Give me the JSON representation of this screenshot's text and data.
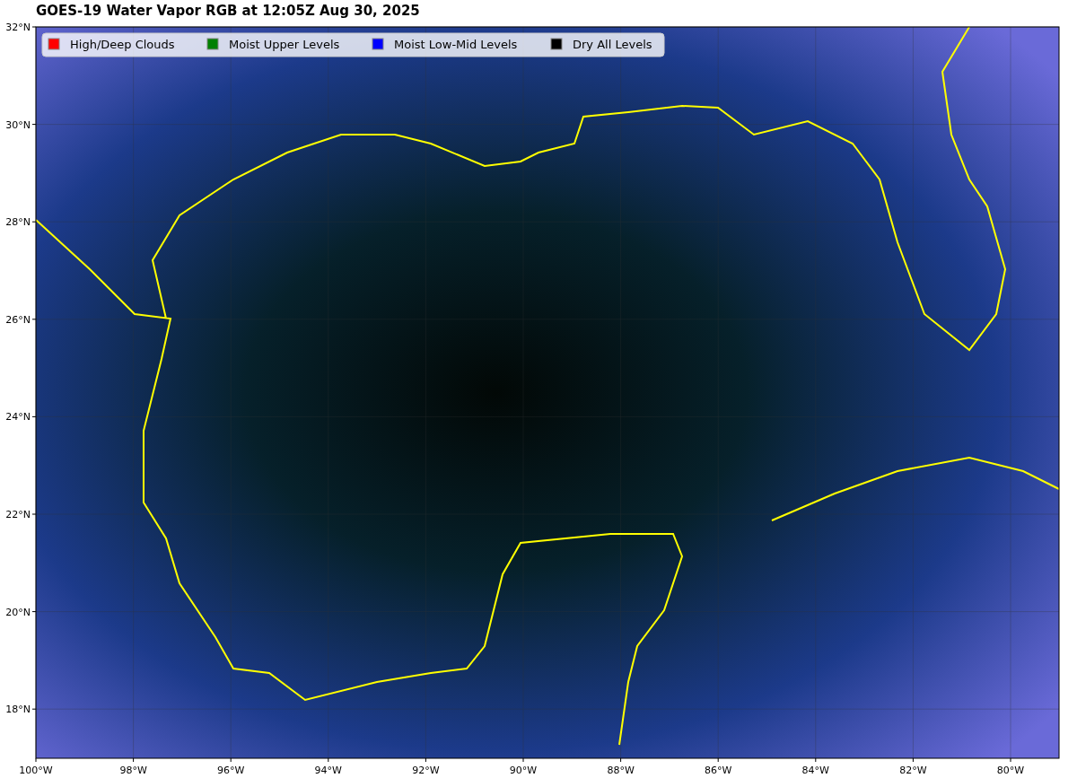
{
  "title": "GOES-19 Water Vapor RGB at 12:05Z Aug 30, 2025",
  "legend": [
    {
      "label": "High/Deep Clouds",
      "color": "#ff0000"
    },
    {
      "label": "Moist Upper Levels",
      "color": "#008000"
    },
    {
      "label": "Moist Low-Mid Levels",
      "color": "#0000ff"
    },
    {
      "label": "Dry All Levels",
      "color": "#000000"
    }
  ],
  "axes": {
    "lat_labels": [
      "32°N",
      "30°N",
      "28°N",
      "26°N",
      "24°N",
      "22°N",
      "20°N",
      "18°N"
    ],
    "lon_labels": [
      "100°W",
      "98°W",
      "96°W",
      "94°W",
      "92°W",
      "90°W",
      "88°W",
      "86°W",
      "84°W",
      "82°W",
      "80°W"
    ]
  }
}
